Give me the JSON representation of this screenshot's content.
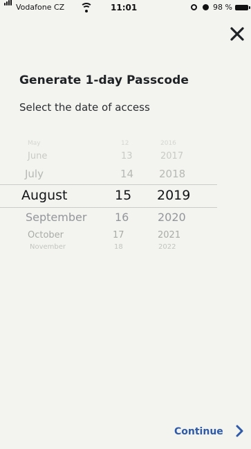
{
  "status_bar": {
    "carrier": "Vodafone CZ",
    "time": "11:01",
    "battery": "98 %"
  },
  "screen": {
    "title": "Generate 1-day Passcode",
    "subtitle": "Select the date of access"
  },
  "picker": {
    "rows": [
      {
        "month": "May",
        "day": "12",
        "year": "2016"
      },
      {
        "month": "June",
        "day": "13",
        "year": "2017"
      },
      {
        "month": "July",
        "day": "14",
        "year": "2018"
      },
      {
        "month": "August",
        "day": "15",
        "year": "2019"
      },
      {
        "month": "September",
        "day": "16",
        "year": "2020"
      },
      {
        "month": "October",
        "day": "17",
        "year": "2021"
      },
      {
        "month": "November",
        "day": "18",
        "year": "2022"
      }
    ],
    "selected_index": 3
  },
  "footer": {
    "continue_label": "Continue"
  },
  "colors": {
    "background": "#f3f4f0",
    "text": "#1f2225",
    "accent": "#2e5aa8"
  },
  "icons": {
    "close": "close-icon",
    "continue": "chevron-right-icon"
  }
}
